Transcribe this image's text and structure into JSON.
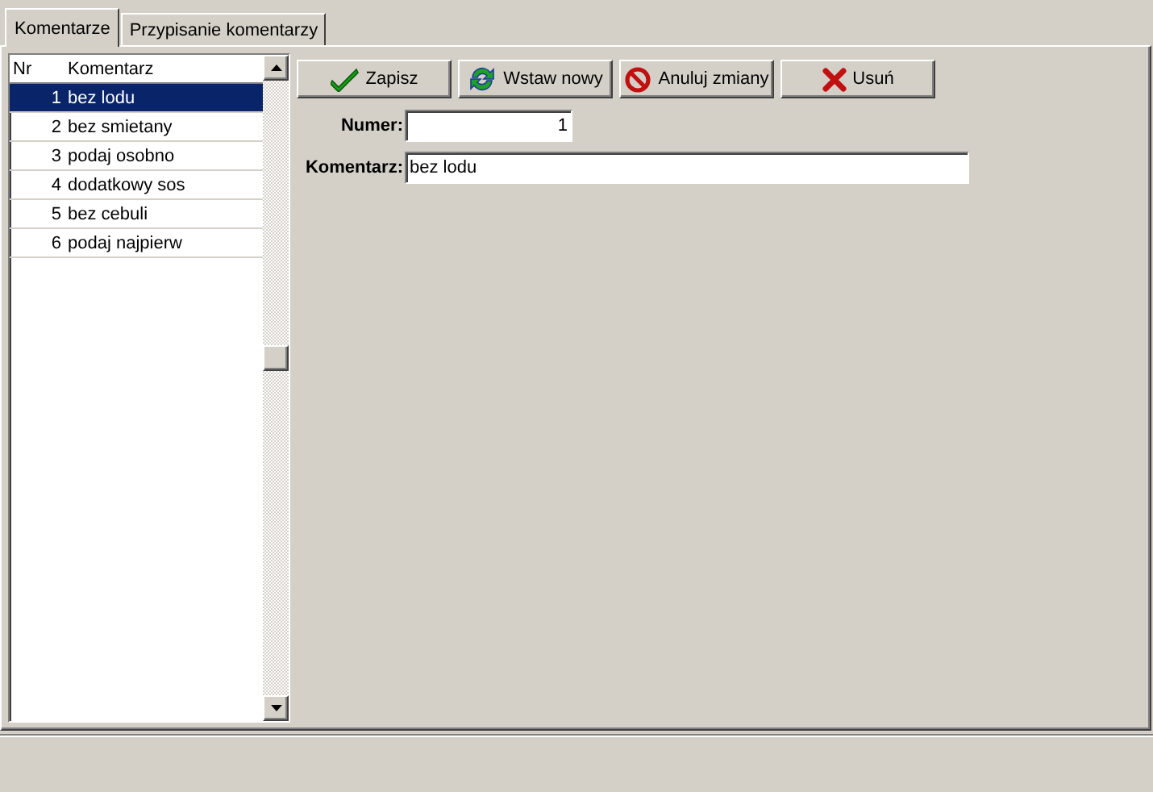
{
  "tabs": [
    {
      "label": "Komentarze",
      "selected": true
    },
    {
      "label": "Przypisanie komentarzy",
      "selected": false
    }
  ],
  "list": {
    "columns": [
      "Nr",
      "Komentarz"
    ],
    "rows": [
      {
        "nr": "1",
        "text": "bez lodu",
        "selected": true
      },
      {
        "nr": "2",
        "text": "bez smietany",
        "selected": false
      },
      {
        "nr": "3",
        "text": "podaj osobno",
        "selected": false
      },
      {
        "nr": "4",
        "text": "dodatkowy sos",
        "selected": false
      },
      {
        "nr": "5",
        "text": "bez cebuli",
        "selected": false
      },
      {
        "nr": "6",
        "text": "podaj najpierw",
        "selected": false
      }
    ]
  },
  "toolbar": [
    {
      "kind": "save",
      "label": "Zapisz"
    },
    {
      "kind": "insert",
      "label": "Wstaw nowy"
    },
    {
      "kind": "cancel",
      "label": "Anuluj zmiany"
    },
    {
      "kind": "delete",
      "label": "Usuń"
    }
  ],
  "form": {
    "fields": [
      {
        "label": "Numer:",
        "value": "1",
        "kind": "number"
      },
      {
        "label": "Komentarz:",
        "value": "bez lodu",
        "kind": "text"
      }
    ]
  }
}
